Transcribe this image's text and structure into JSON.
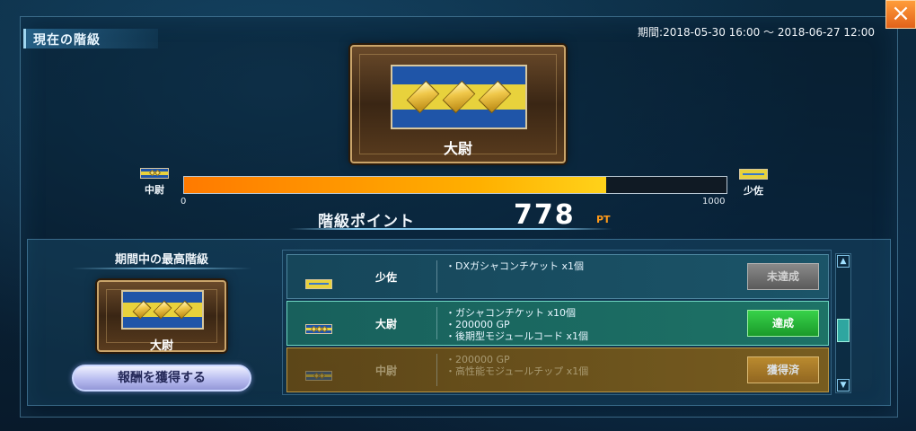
{
  "header": {
    "title": "現在の階級",
    "period": "期間:2018-05-30 16:00 ～ 2018-06-27 12:00"
  },
  "current_rank": {
    "name": "大尉",
    "insignia": "captain-three-diamonds"
  },
  "progress": {
    "prev_rank": "中尉",
    "next_rank": "少佐",
    "min": "0",
    "max": "1000",
    "value": 778,
    "fraction": 0.778
  },
  "points": {
    "label": "階級ポイント",
    "value": "778",
    "unit": "PT"
  },
  "highest": {
    "title": "期間中の最高階級",
    "rank_name": "大尉"
  },
  "claim_button": "報酬を獲得する",
  "rewards": [
    {
      "rank": "少佐",
      "items": [
        "・DXガシャコンチケット x1個"
      ],
      "status": "未達成",
      "state": "locked"
    },
    {
      "rank": "大尉",
      "items": [
        "・ガシャコンチケット x10個",
        "・200000 GP",
        "・後期型モジュールコード x1個"
      ],
      "status": "達成",
      "state": "claimable"
    },
    {
      "rank": "中尉",
      "items": [
        "・200000 GP",
        "・高性能モジュールチップ x1個"
      ],
      "status": "獲得済",
      "state": "claimed"
    }
  ],
  "scroll": {
    "up": "▲",
    "down": "▼"
  },
  "colors": {
    "progress": "#ff8a00",
    "achieved": "#2bb83a",
    "claimed": "#c08424",
    "locked": "#707070"
  }
}
